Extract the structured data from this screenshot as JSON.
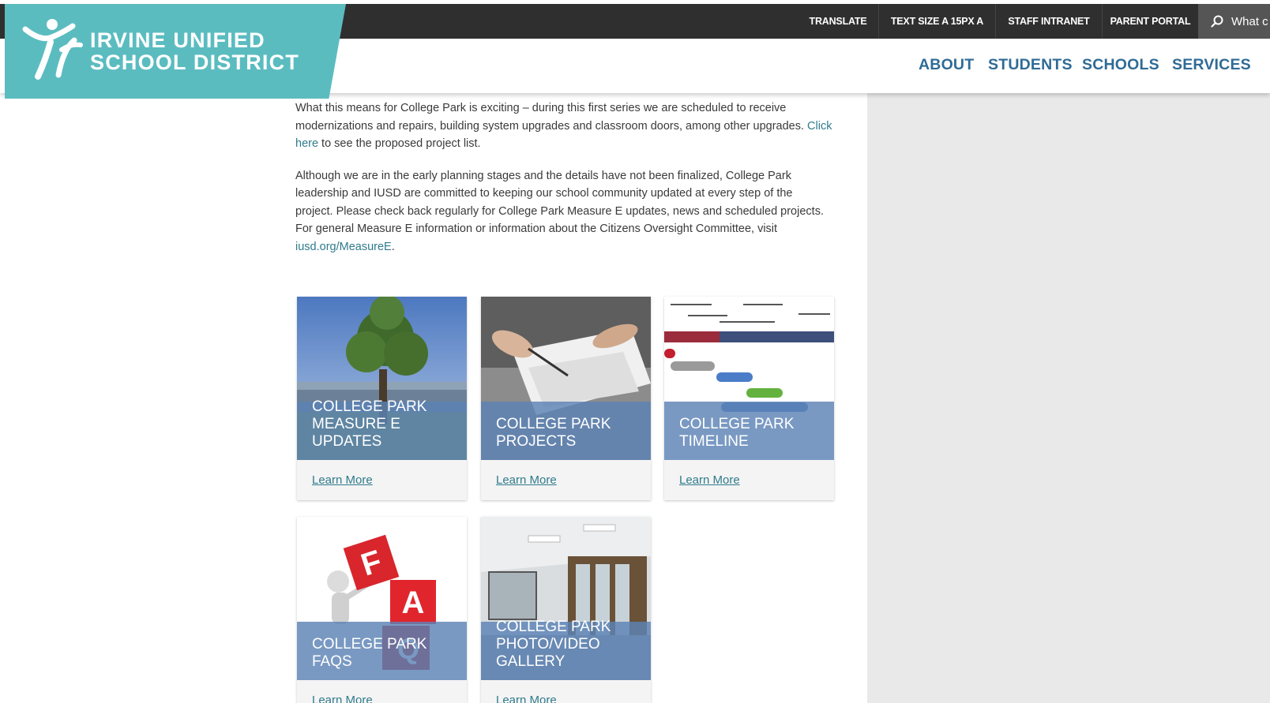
{
  "logo": {
    "line1": "IRVINE UNIFIED",
    "line2": "SCHOOL DISTRICT"
  },
  "utility": {
    "translate": "TRANSLATE",
    "text_size": "TEXT SIZE A 15PX A",
    "staff_intranet": "STAFF INTRANET",
    "parent_portal": "PARENT PORTAL",
    "search_placeholder": "What c"
  },
  "nav": {
    "about": "ABOUT",
    "students": "STUDENTS",
    "schools": "SCHOOLS",
    "services": "SERVICES"
  },
  "content": {
    "p1_before": "What this means for College Park is exciting – during this first series we are scheduled to receive modernizations and repairs, building system upgrades and classroom doors, among other upgrades. ",
    "p1_link": "Click here",
    "p1_after": " to see the proposed project list.",
    "p2_before": "Although we are in the early planning stages and the details have not been finalized, College Park leadership and IUSD are committed to keeping our school community updated at every step of the project. Please check back regularly for College Park Measure E updates, news and scheduled projects. For general Measure E information or information about the Citizens Oversight Committee, visit ",
    "p2_link": "iusd.org/MeasureE",
    "p2_after": "."
  },
  "cards": [
    {
      "title": "COLLEGE PARK MEASURE E UPDATES",
      "link": "Learn More"
    },
    {
      "title": "COLLEGE PARK PROJECTS",
      "link": "Learn More"
    },
    {
      "title": "COLLEGE PARK TIMELINE",
      "link": "Learn More"
    },
    {
      "title": "COLLEGE PARK FAQS",
      "link": "Learn More"
    },
    {
      "title": "COLLEGE PARK PHOTO/VIDEO GALLERY",
      "link": "Learn More"
    }
  ],
  "faq_blocks": {
    "f": "F",
    "a": "A",
    "q": "Q"
  },
  "colors": {
    "logo_bg": "#5bbcc0",
    "topbar": "#2f2f2f",
    "nav_text": "#2f6b96",
    "link": "#2f7b8c",
    "card_overlay": "#5c82b4"
  }
}
